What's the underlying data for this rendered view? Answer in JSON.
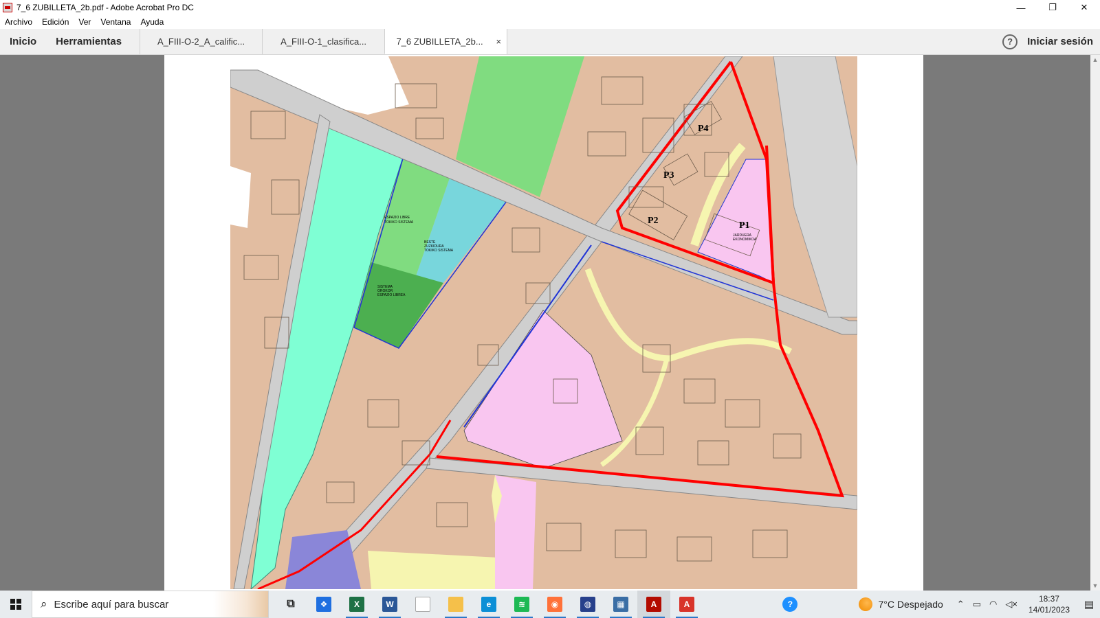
{
  "window": {
    "title": "7_6 ZUBILLETA_2b.pdf - Adobe Acrobat Pro DC",
    "minimize_glyph": "—",
    "restore_glyph": "❐",
    "close_glyph": "✕"
  },
  "menu": {
    "items": [
      "Archivo",
      "Edición",
      "Ver",
      "Ventana",
      "Ayuda"
    ]
  },
  "toolbar": {
    "home_label": "Inicio",
    "tools_label": "Herramientas",
    "tabs": [
      {
        "label": "A_FIII-O-2_A_calific..."
      },
      {
        "label": "A_FIII-O-1_clasifica..."
      },
      {
        "label": "7_6 ZUBILLETA_2b...",
        "close": "×"
      }
    ],
    "help_glyph": "?",
    "signin_label": "Iniciar sesión"
  },
  "map": {
    "labels": {
      "p1": "P1",
      "p2": "P2",
      "p3": "P3",
      "p4": "P4",
      "libre_1": "ESPAZIO LIBRE",
      "libre_2": "TOKIKO SISTEMA",
      "beste_1": "BESTE",
      "beste_2": "ZUZKIDURA",
      "beste_3": "TOKIKO SISTEMA",
      "sistema_1": "SISTEMA",
      "sistema_2": "OROKOR",
      "sistema_3": "ESPAZIO LIBREA",
      "jarduera_1": "JARDUERA",
      "jarduera_2": "EKONOMIKOA"
    },
    "colors": {
      "residential": "#e2bda1",
      "river_park": "#7fffd4",
      "light_green": "#80dc80",
      "dark_green": "#4caf50",
      "cyan_area": "#78d6dc",
      "pink": "#f9c6f0",
      "yellow_path": "#f6f5b0",
      "road": "#d6d6d6",
      "red_boundary": "#ff0000",
      "blue_boundary": "#1f33d6",
      "purple": "#8a86d8"
    }
  },
  "taskbar": {
    "search_placeholder": "Escribe aquí para buscar",
    "weather": "7°C  Despejado",
    "time": "18:37",
    "date": "14/01/2023",
    "apps": [
      {
        "name": "task-view-icon",
        "label": "⧉",
        "color": "#222"
      },
      {
        "name": "dropbox-icon",
        "label": "❖",
        "color": "#1f6fe0"
      },
      {
        "name": "excel-icon",
        "label": "X",
        "color": "#1e7145"
      },
      {
        "name": "word-icon",
        "label": "W",
        "color": "#2b5797"
      },
      {
        "name": "notepad-icon",
        "label": "",
        "color": "#ffffff"
      },
      {
        "name": "file-explorer-icon",
        "label": "",
        "color": "#f5c04a"
      },
      {
        "name": "edge-icon",
        "label": "e",
        "color": "#0c8fd6"
      },
      {
        "name": "spotify-icon",
        "label": "≋",
        "color": "#1db954"
      },
      {
        "name": "firefox-icon",
        "label": "◉",
        "color": "#ff7139"
      },
      {
        "name": "globe-app-icon",
        "label": "◍",
        "color": "#27408b"
      },
      {
        "name": "calculator-icon",
        "label": "▦",
        "color": "#3a6ea5"
      },
      {
        "name": "acrobat-pro-icon",
        "label": "A",
        "color": "#b30b00"
      },
      {
        "name": "acrobat-reader-icon",
        "label": "A",
        "color": "#d8342a"
      }
    ],
    "help_glyph": "?"
  }
}
